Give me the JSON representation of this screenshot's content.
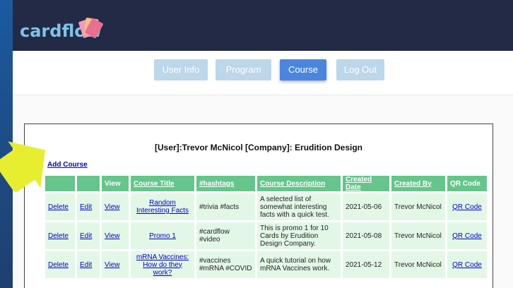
{
  "app": {
    "logo_text": "cardflow",
    "colors": {
      "header_bg": "#222a45",
      "accent": "#4a86e0",
      "table_header": "#65c58a",
      "row_bg": "#e3f7e6",
      "arrow": "#e6ee2f"
    }
  },
  "nav": {
    "items": [
      {
        "label": "User Info"
      },
      {
        "label": "Program"
      },
      {
        "label": "Course"
      },
      {
        "label": "Log Out"
      }
    ],
    "active": "Course"
  },
  "panel": {
    "user_line": "[User]:Trevor McNicol [Company]: Erudition Design",
    "add_link": "Add Course"
  },
  "table": {
    "headers": [
      "",
      "",
      "View",
      "Course Title",
      "#hashtags",
      "Course Description",
      "Created Date",
      "Created By",
      "QR Code"
    ],
    "rows": [
      {
        "delete": "Delete",
        "edit": "Edit",
        "view": "View",
        "title": "Random Interesting Facts",
        "hashtags": "#trivia #facts",
        "description": "A selected list of somewhat interesting facts with a quick test.",
        "date": "2021-05-06",
        "by": "Trevor McNicol",
        "qr": "QR Code"
      },
      {
        "delete": "Delete",
        "edit": "Edit",
        "view": "View",
        "title": "Promo 1",
        "hashtags": "#cardflow #video",
        "description": "This is promo 1 for 10 Cards by Erudition Design Company.",
        "date": "2021-05-08",
        "by": "Trevor McNicol",
        "qr": "QR Code"
      },
      {
        "delete": "Delete",
        "edit": "Edit",
        "view": "View",
        "title": "mRNA Vaccines: How do they work?",
        "hashtags": "#vaccines #mRNA #COVID",
        "description": "A quick tutorial on how mRNA Vaccines work.",
        "date": "2021-05-12",
        "by": "Trevor McNicol",
        "qr": "QR Code"
      }
    ]
  }
}
